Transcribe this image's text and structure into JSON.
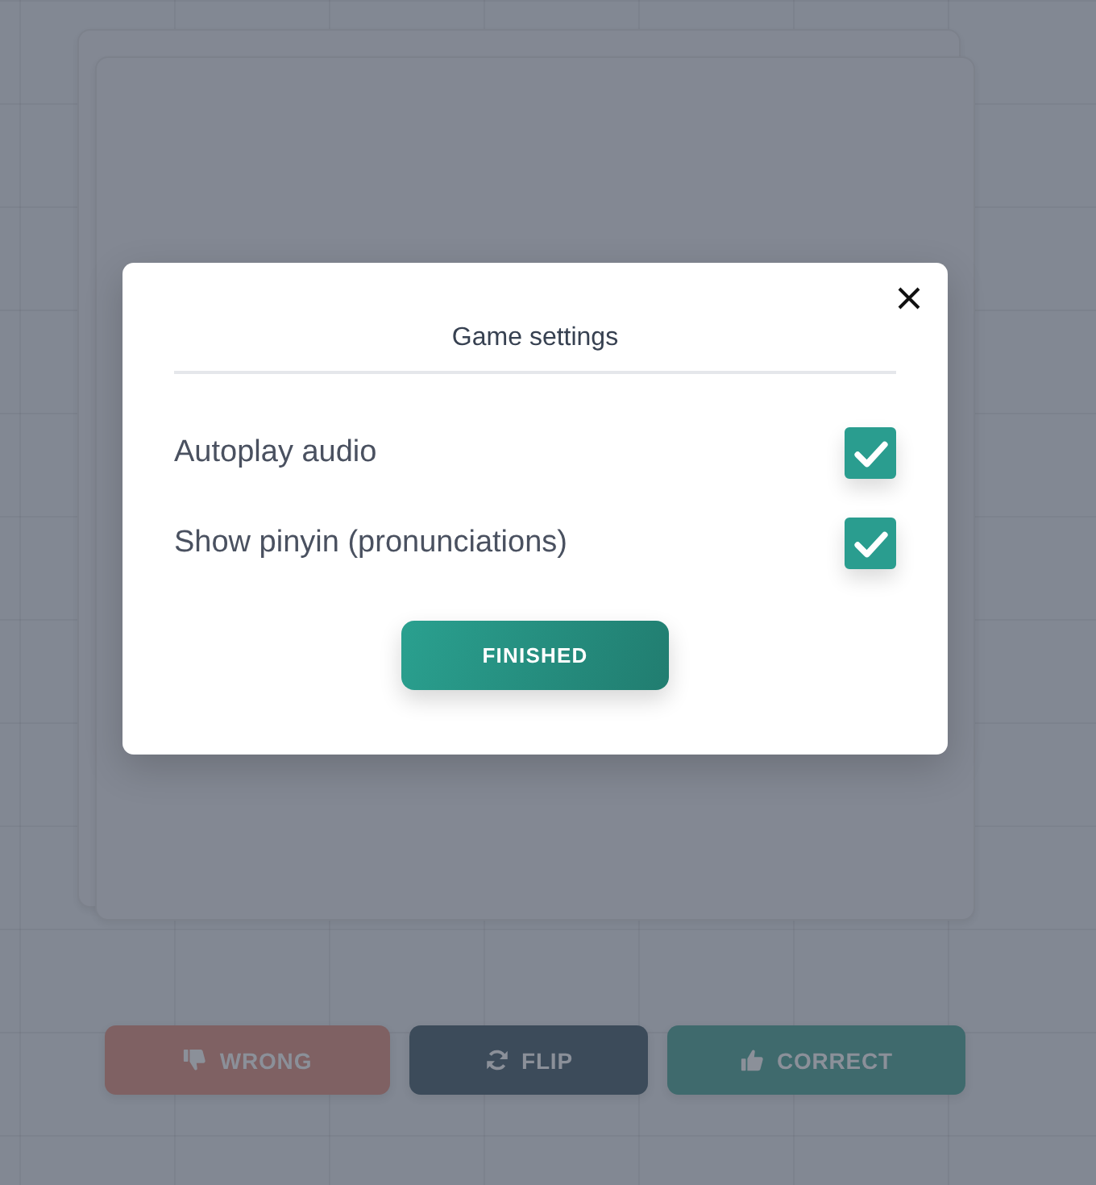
{
  "modal": {
    "title": "Game settings",
    "settings": [
      {
        "label": "Autoplay audio",
        "checked": true
      },
      {
        "label": "Show pinyin (pronunciations)",
        "checked": true
      }
    ],
    "finish_button": "FINISHED"
  },
  "actions": [
    {
      "kind": "wrong",
      "label": "WRONG"
    },
    {
      "kind": "flip",
      "label": "FLIP"
    },
    {
      "kind": "correct",
      "label": "CORRECT"
    }
  ]
}
